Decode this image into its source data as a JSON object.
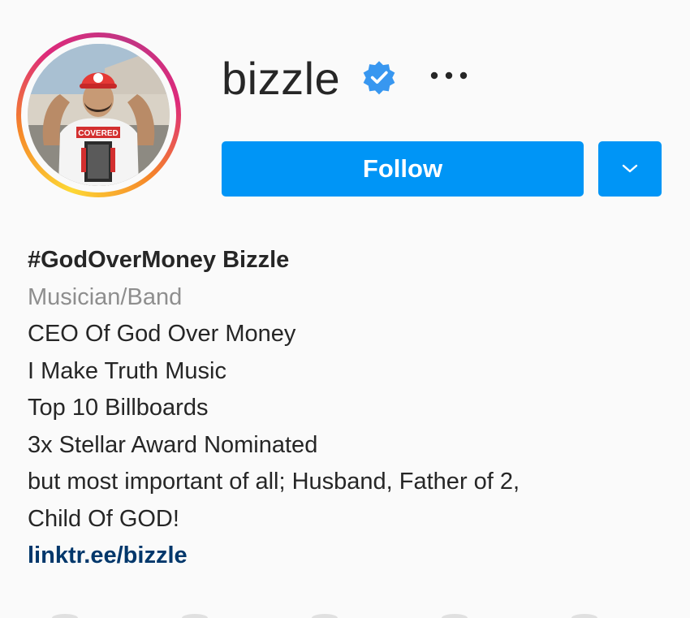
{
  "profile": {
    "username": "bizzle",
    "verified": true,
    "more_icon": "more-horizontal-icon"
  },
  "actions": {
    "follow_label": "Follow",
    "dropdown_icon": "chevron-down-icon"
  },
  "bio": {
    "name": "#GodOverMoney Bizzle",
    "category": "Musician/Band",
    "lines": [
      "CEO Of God Over Money",
      "I Make Truth Music",
      "Top 10 Billboards",
      "3x Stellar Award Nominated",
      "but most important of all; Husband, Father of 2,",
      "Child Of GOD!"
    ],
    "link": "linktr.ee/bizzle"
  },
  "avatar_shirt_text": "COVERED",
  "colors": {
    "accent": "#0095f6",
    "link": "#00376b",
    "muted": "#8e8e8e",
    "text": "#262626",
    "verified": "#3897f0"
  }
}
